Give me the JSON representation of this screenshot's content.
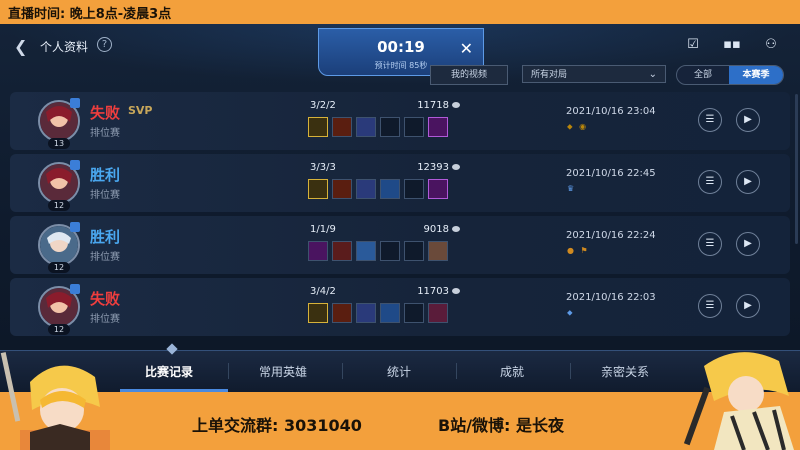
{
  "stream": {
    "top_banner": "直播时间: 晚上8点-凌晨3点",
    "group": "上单交流群: 3031040",
    "social": "B站/微博: 是长夜"
  },
  "header": {
    "back_icon": "chevron-left-icon",
    "title": "个人资料",
    "help_icon": "question-circle-icon",
    "timer": "00:19",
    "timer_sub": "预计时间 85秒",
    "my_video": "我的视频",
    "filter_value": "所有对局",
    "seg_all": "全部",
    "seg_season": "本赛季",
    "icons": [
      "checklist-icon",
      "chat-icon",
      "friends-icon"
    ]
  },
  "matches": [
    {
      "result": "失败",
      "outcome": "lose",
      "svp": "SVP",
      "mode": "排位赛",
      "level": "13",
      "kda": "3/2/2",
      "gold": "11718",
      "date": "2021/10/16 23:04",
      "marks": "⬥ ◉"
    },
    {
      "result": "胜利",
      "outcome": "win",
      "svp": "",
      "mode": "排位赛",
      "level": "12",
      "kda": "3/3/3",
      "gold": "12393",
      "date": "2021/10/16 22:45",
      "marks": "♛"
    },
    {
      "result": "胜利",
      "outcome": "win",
      "svp": "",
      "mode": "排位赛",
      "level": "12",
      "kda": "1/1/9",
      "gold": "9018",
      "date": "2021/10/16 22:24",
      "marks": "● ⚑"
    },
    {
      "result": "失败",
      "outcome": "lose",
      "svp": "",
      "mode": "排位赛",
      "level": "12",
      "kda": "3/4/2",
      "gold": "11703",
      "date": "2021/10/16 22:03",
      "marks": "⬥"
    }
  ],
  "tabs": [
    "比赛记录",
    "常用英雄",
    "统计",
    "成就",
    "亲密关系"
  ],
  "colors": {
    "banner": "#f3a03c",
    "lose": "#ee3e3e",
    "win": "#4aa8f0",
    "accent": "#2d6fc8"
  }
}
